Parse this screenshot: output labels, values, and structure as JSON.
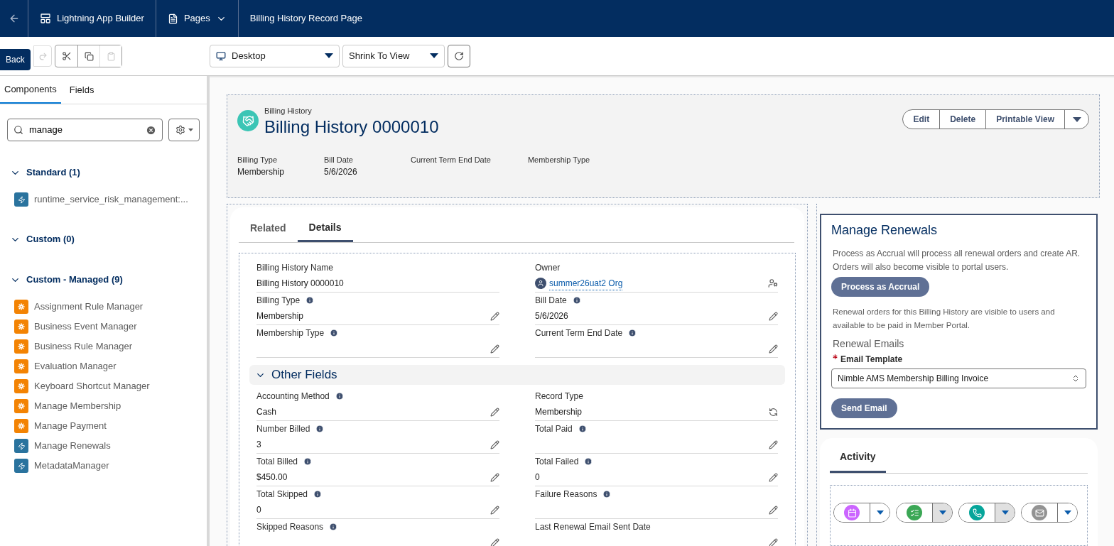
{
  "topbar": {
    "back_tooltip": "Back",
    "app_title": "Lightning App Builder",
    "pages_menu": "Pages",
    "page_title": "Billing History Record Page"
  },
  "toolbar": {
    "device": "Desktop",
    "zoom": "Shrink To View"
  },
  "sidebar": {
    "tabs": [
      {
        "label": "Components",
        "selected": true
      },
      {
        "label": "Fields",
        "selected": false
      }
    ],
    "search": {
      "value": "manage"
    },
    "groups": [
      {
        "title": "Standard (1)",
        "expanded": true,
        "items": [
          {
            "label": "runtime_service_risk_management:...",
            "kind": "lightning"
          }
        ]
      },
      {
        "title": "Custom (0)",
        "expanded": true
      },
      {
        "title": "Custom - Managed (9)",
        "expanded": true,
        "items": [
          {
            "label": "Assignment Rule Manager",
            "kind": "managed"
          },
          {
            "label": "Business Event Manager",
            "kind": "managed"
          },
          {
            "label": "Business Rule Manager",
            "kind": "managed"
          },
          {
            "label": "Evaluation Manager",
            "kind": "managed"
          },
          {
            "label": "Keyboard Shortcut Manager",
            "kind": "managed"
          },
          {
            "label": "Manage Membership",
            "kind": "managed"
          },
          {
            "label": "Manage Payment",
            "kind": "managed"
          },
          {
            "label": "Manage Renewals",
            "kind": "lightning"
          },
          {
            "label": "MetadataManager",
            "kind": "lightning"
          }
        ]
      }
    ]
  },
  "record_header": {
    "object": "Billing History",
    "title": "Billing History 0000010",
    "actions": [
      "Edit",
      "Delete",
      "Printable View"
    ],
    "highlights": [
      {
        "label": "Billing Type",
        "value": "Membership"
      },
      {
        "label": "Bill Date",
        "value": "5/6/2026"
      },
      {
        "label": "Current Term End Date"
      },
      {
        "label": "Membership Type"
      }
    ]
  },
  "detail_tabs": [
    {
      "label": "Related",
      "selected": false
    },
    {
      "label": "Details",
      "selected": true
    }
  ],
  "fields": [
    {
      "label": "Billing History Name",
      "value": "Billing History 0000010",
      "info": false,
      "kind": "readonly"
    },
    {
      "label": "Owner",
      "value": "summer26uat2 Org",
      "info": false,
      "kind": "owner"
    },
    {
      "label": "Billing Type",
      "value": "Membership",
      "info": true,
      "kind": "editable"
    },
    {
      "label": "Bill Date",
      "value": "5/6/2026",
      "info": true,
      "kind": "editable"
    },
    {
      "label": "Membership Type",
      "info": true,
      "kind": "editable"
    },
    {
      "label": "Current Term End Date",
      "info": true,
      "kind": "editable"
    }
  ],
  "section": {
    "title": "Other Fields",
    "expanded": true,
    "fields": [
      {
        "label": "Accounting Method",
        "value": "Cash",
        "info": true,
        "kind": "editable"
      },
      {
        "label": "Record Type",
        "value": "Membership",
        "info": false,
        "kind": "record-type"
      },
      {
        "label": "Number Billed",
        "value": "3",
        "info": true,
        "kind": "editable"
      },
      {
        "label": "Total Paid",
        "info": true,
        "kind": "editable"
      },
      {
        "label": "Total Billed",
        "value": "$450.00",
        "info": true,
        "kind": "editable"
      },
      {
        "label": "Total Failed",
        "value": "0",
        "info": true,
        "kind": "editable"
      },
      {
        "label": "Total Skipped",
        "value": "0",
        "info": true,
        "kind": "editable"
      },
      {
        "label": "Failure Reasons",
        "info": true,
        "kind": "editable"
      },
      {
        "label": "Skipped Reasons",
        "info": true,
        "kind": "editable"
      },
      {
        "label": "Last Renewal Email Sent Date",
        "info": false,
        "kind": "editable"
      }
    ]
  },
  "renewals": {
    "title": "Manage Renewals",
    "accrual_text": "Process as Accrual will process all renewal orders and create AR. Orders will also become visible to portal users.",
    "accrual_button": "Process as Accrual",
    "portal_text": "Renewal orders for this Billing History are visible to users and available to be paid in Member Portal.",
    "emails_heading": "Renewal Emails",
    "template_label": "Email Template",
    "template_required": true,
    "template_value": "Nimble AMS Membership Billing Invoice",
    "send_button": "Send Email"
  },
  "activity": {
    "tabs": [
      {
        "label": "Activity",
        "selected": true
      }
    ],
    "buttons": [
      {
        "kind": "event",
        "color": "#cb65ff",
        "menu_pressed": false
      },
      {
        "kind": "task",
        "color": "#3ba755",
        "menu_pressed": true
      },
      {
        "kind": "call",
        "color": "#06a59a",
        "menu_pressed": true
      },
      {
        "kind": "email",
        "color": "#939393",
        "menu_pressed": false
      }
    ]
  }
}
